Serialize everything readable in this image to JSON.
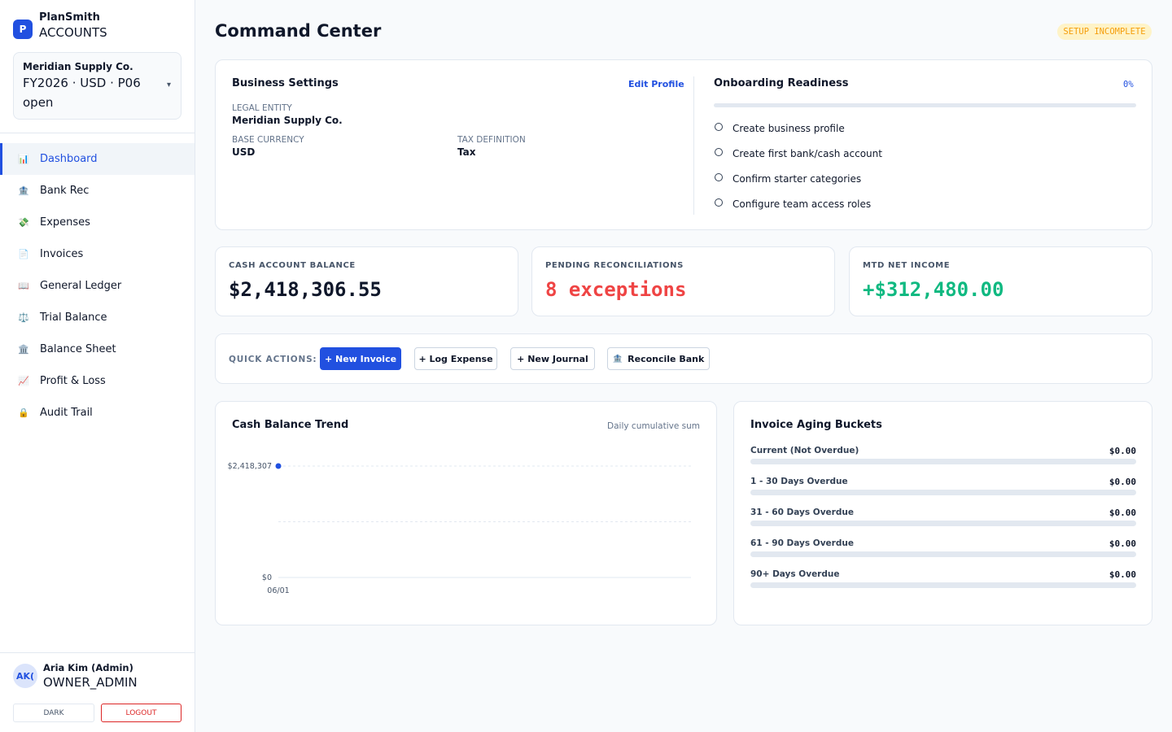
{
  "brand": {
    "logo_letter": "P",
    "name": "PlanSmith",
    "sub": "ACCOUNTS"
  },
  "company": {
    "name": "Meridian Supply Co.",
    "period": "FY2026 · USD · P06 open",
    "caret": "▾"
  },
  "nav": [
    {
      "label": "Dashboard",
      "icon": "bar-chart-icon",
      "glyph": "📊",
      "active": true
    },
    {
      "label": "Bank Rec",
      "icon": "bank-icon",
      "glyph": "🏦",
      "active": false
    },
    {
      "label": "Expenses",
      "icon": "money-icon",
      "glyph": "💸",
      "active": false
    },
    {
      "label": "Invoices",
      "icon": "document-icon",
      "glyph": "📄",
      "active": false
    },
    {
      "label": "General Ledger",
      "icon": "book-icon",
      "glyph": "📖",
      "active": false
    },
    {
      "label": "Trial Balance",
      "icon": "scales-icon",
      "glyph": "⚖️",
      "active": false
    },
    {
      "label": "Balance Sheet",
      "icon": "building-icon",
      "glyph": "🏛️",
      "active": false
    },
    {
      "label": "Profit & Loss",
      "icon": "line-chart-icon",
      "glyph": "📈",
      "active": false
    },
    {
      "label": "Audit Trail",
      "icon": "lock-icon",
      "glyph": "🔒",
      "active": false
    }
  ],
  "user": {
    "initials": "AK(",
    "name": "Aria Kim (Admin)",
    "role": "OWNER_ADMIN",
    "dark_label": "DARK",
    "logout_label": "LOGOUT"
  },
  "header": {
    "title": "Command Center",
    "badge": "SETUP INCOMPLETE"
  },
  "settings": {
    "title": "Business Settings",
    "edit_label": "Edit Profile",
    "legal_entity_label": "LEGAL ENTITY",
    "legal_entity_value": "Meridian Supply Co.",
    "base_currency_label": "BASE CURRENCY",
    "base_currency_value": "USD",
    "tax_definition_label": "TAX DEFINITION",
    "tax_definition_value": "Tax"
  },
  "onboarding": {
    "title": "Onboarding Readiness",
    "percent_label": "0%",
    "progress": 0,
    "items": [
      "Create business profile",
      "Create first bank/cash account",
      "Confirm starter categories",
      "Configure team access roles"
    ]
  },
  "kpis": [
    {
      "label": "CASH ACCOUNT BALANCE",
      "value": "$2,418,306.55",
      "color": "#0f172a"
    },
    {
      "label": "PENDING RECONCILIATIONS",
      "value": "8 exceptions",
      "color": "#ef4444"
    },
    {
      "label": "MTD NET INCOME",
      "value": "+$312,480.00",
      "color": "#10b981"
    }
  ],
  "quick_actions": {
    "label": "QUICK ACTIONS:",
    "new_invoice": "+ New Invoice",
    "log_expense": "+ Log Expense",
    "new_journal": "+ New Journal",
    "reconcile_bank": "Reconcile Bank",
    "reconcile_icon": "bank-icon",
    "reconcile_glyph": "🏦"
  },
  "trend": {
    "title": "Cash Balance Trend",
    "subtitle": "Daily cumulative sum"
  },
  "chart_data": {
    "type": "line",
    "x": [
      "06/01"
    ],
    "series": [
      {
        "values": [
          2418307
        ]
      }
    ],
    "y_tick_labels": [
      "$2,418,307",
      "$0"
    ],
    "ylim": [
      0,
      2418307
    ],
    "grid": true,
    "color": "#2150e0"
  },
  "aging": {
    "title": "Invoice Aging Buckets",
    "buckets": [
      {
        "label": "Current (Not Overdue)",
        "amount": "$0.00",
        "fill": 0
      },
      {
        "label": "1 - 30 Days Overdue",
        "amount": "$0.00",
        "fill": 0
      },
      {
        "label": "31 - 60 Days Overdue",
        "amount": "$0.00",
        "fill": 0
      },
      {
        "label": "61 - 90 Days Overdue",
        "amount": "$0.00",
        "fill": 0
      },
      {
        "label": "90+ Days Overdue",
        "amount": "$0.00",
        "fill": 0
      }
    ]
  },
  "colors": {
    "accent": "#2150e0",
    "warning": "#f59e0b",
    "danger": "#ef4444",
    "success": "#10b981"
  }
}
